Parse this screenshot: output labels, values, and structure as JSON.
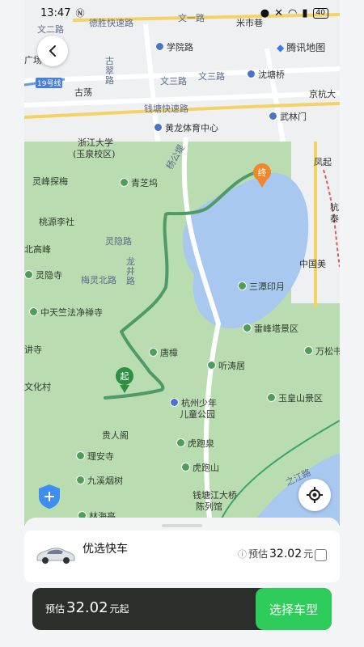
{
  "status_bar": {
    "time": "13:47",
    "battery": "40"
  },
  "map": {
    "brand": "腾讯地图",
    "marker_start": "起",
    "marker_end": "终",
    "road_labels": [
      "德胜快速路",
      "文一路",
      "文二路",
      "古翠路",
      "文三路",
      "文三路",
      "钱塘快速路",
      "19号线",
      "龙井路",
      "灵隐路",
      "梅灵北路",
      "杨公堤",
      "之江路"
    ],
    "place_labels": [
      "米市巷",
      "广场",
      "学院路",
      "古荡",
      "沈塘桥",
      "京杭大",
      "武林门",
      "黄龙体育中心",
      "浙江大学",
      "(玉泉校区)",
      "凤起",
      "灵峰探梅",
      "青芝坞",
      "桃源李社",
      "北高峰",
      "灵隐寺",
      "中天竺法净禅寺",
      "讲寺",
      "三潭印月",
      "中国美",
      "雷峰塔景区",
      "万松书",
      "唐樟",
      "听涛居",
      "杭州少年",
      "儿童公园",
      "玉皇山景区",
      "文化村",
      "贵人阁",
      "虎跑泉",
      "理安寺",
      "虎跑山",
      "九溪烟树",
      "林海亭",
      "钱塘江大桥",
      "陈列馆",
      "杭",
      "泰"
    ]
  },
  "ride_option": {
    "name": "优选快车",
    "estimate_prefix": "预估",
    "price": "32.02",
    "unit": "元"
  },
  "bottom_bar": {
    "estimate_prefix": "预估",
    "price": "32.02",
    "suffix": "元起",
    "cta": "选择车型"
  }
}
